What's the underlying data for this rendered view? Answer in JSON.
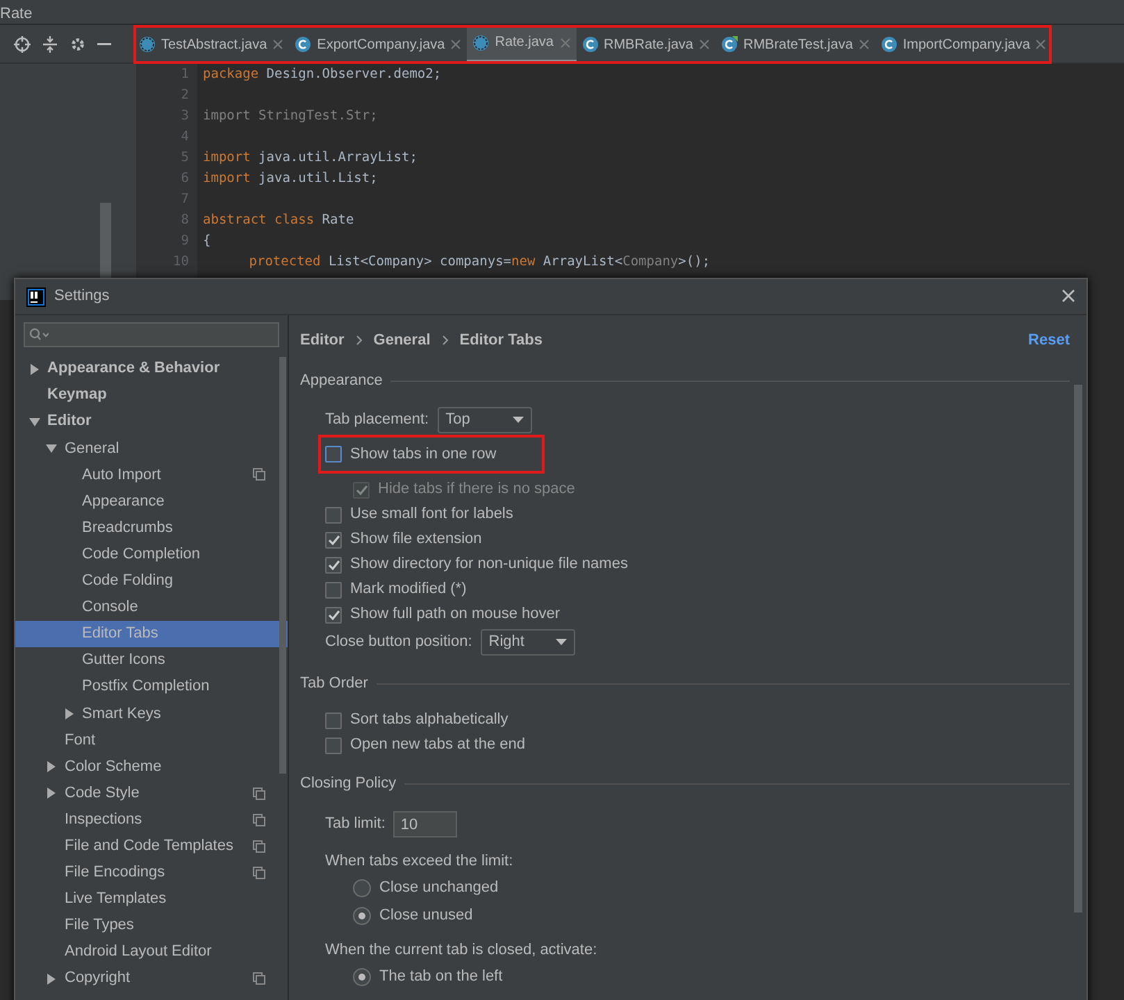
{
  "window": {
    "title": "Rate"
  },
  "editor_tabs": {
    "highlighted": true,
    "items": [
      {
        "label": "TestAbstract.java",
        "kind": "abstract",
        "selected": false
      },
      {
        "label": "ExportCompany.java",
        "kind": "class",
        "selected": false
      },
      {
        "label": "Rate.java",
        "kind": "abstract",
        "selected": true
      },
      {
        "label": "RMBRate.java",
        "kind": "class",
        "selected": false
      },
      {
        "label": "RMBrateTest.java",
        "kind": "test",
        "selected": false
      },
      {
        "label": "ImportCompany.java",
        "kind": "class",
        "selected": false
      }
    ]
  },
  "code": [
    {
      "number": "1",
      "segments": [
        {
          "kind": "keyword",
          "text": "package"
        },
        {
          "kind": "plain",
          "text": " Design.Observer.demo2;"
        }
      ]
    },
    {
      "number": "2"
    },
    {
      "number": "3",
      "segments": [
        {
          "kind": "muted",
          "text": "import StringTest.Str;"
        }
      ]
    },
    {
      "number": "4"
    },
    {
      "number": "5",
      "segments": [
        {
          "kind": "keyword",
          "text": "import"
        },
        {
          "kind": "plain",
          "text": " java.util.ArrayList;"
        }
      ]
    },
    {
      "number": "6",
      "segments": [
        {
          "kind": "keyword",
          "text": "import"
        },
        {
          "kind": "plain",
          "text": " java.util.List;"
        }
      ]
    },
    {
      "number": "7"
    },
    {
      "number": "8",
      "segments": [
        {
          "kind": "keyword",
          "text": "abstract class"
        },
        {
          "kind": "plain",
          "text": " Rate"
        }
      ]
    },
    {
      "number": "9",
      "segments": [
        {
          "kind": "plain",
          "text": "{"
        }
      ]
    },
    {
      "number": "10",
      "indented": true,
      "segments": [
        {
          "kind": "keyword",
          "text": "protected"
        },
        {
          "kind": "plain",
          "text": " List<Company> companys="
        },
        {
          "kind": "keyword",
          "text": "new"
        },
        {
          "kind": "plain",
          "text": " ArrayList<"
        },
        {
          "kind": "muted",
          "text": "Company"
        },
        {
          "kind": "plain",
          "text": ">();"
        }
      ]
    }
  ],
  "dialog": {
    "title": "Settings",
    "tree": [
      {
        "label": "Appearance & Behavior",
        "expanded": false,
        "shared": false,
        "selected": false
      },
      {
        "label": "Keymap",
        "shared": false,
        "selected": false
      },
      {
        "label": "Editor",
        "expanded": true,
        "shared": false,
        "selected": false,
        "children": [
          {
            "label": "General",
            "expanded": true,
            "shared": false,
            "selected": false,
            "children": [
              {
                "label": "Auto Import",
                "shared": true,
                "selected": false
              },
              {
                "label": "Appearance",
                "shared": false,
                "selected": false
              },
              {
                "label": "Breadcrumbs",
                "shared": false,
                "selected": false
              },
              {
                "label": "Code Completion",
                "shared": false,
                "selected": false
              },
              {
                "label": "Code Folding",
                "shared": false,
                "selected": false
              },
              {
                "label": "Console",
                "shared": false,
                "selected": false
              },
              {
                "label": "Editor Tabs",
                "shared": false,
                "selected": true
              },
              {
                "label": "Gutter Icons",
                "shared": false,
                "selected": false
              },
              {
                "label": "Postfix Completion",
                "shared": false,
                "selected": false
              },
              {
                "label": "Smart Keys",
                "expanded": false,
                "shared": false,
                "selected": false
              }
            ]
          },
          {
            "label": "Font",
            "shared": false,
            "selected": false
          },
          {
            "label": "Color Scheme",
            "expanded": false,
            "shared": false,
            "selected": false
          },
          {
            "label": "Code Style",
            "expanded": false,
            "shared": true,
            "selected": false
          },
          {
            "label": "Inspections",
            "shared": true,
            "selected": false
          },
          {
            "label": "File and Code Templates",
            "shared": true,
            "selected": false
          },
          {
            "label": "File Encodings",
            "shared": true,
            "selected": false
          },
          {
            "label": "Live Templates",
            "shared": false,
            "selected": false
          },
          {
            "label": "File Types",
            "shared": false,
            "selected": false
          },
          {
            "label": "Android Layout Editor",
            "shared": false,
            "selected": false
          },
          {
            "label": "Copyright",
            "expanded": false,
            "shared": true,
            "selected": false
          }
        ]
      }
    ],
    "breadcrumb": [
      "Editor",
      "General",
      "Editor Tabs"
    ],
    "reset": "Reset",
    "sections": [
      {
        "title": "Appearance",
        "items": [
          {
            "kind": "select",
            "label": "Tab placement:",
            "value": "Top"
          },
          {
            "kind": "checkbox",
            "label": "Show tabs in one row",
            "checked": false,
            "disabled": false,
            "highlighted": true,
            "children": [
              {
                "kind": "checkbox",
                "label": "Hide tabs if there is no space",
                "checked": true,
                "disabled": true,
                "highlighted": false
              }
            ]
          },
          {
            "kind": "checkbox",
            "label": "Use small font for labels",
            "checked": false,
            "disabled": false,
            "highlighted": false
          },
          {
            "kind": "checkbox",
            "label": "Show file extension",
            "checked": true,
            "disabled": false,
            "highlighted": false
          },
          {
            "kind": "checkbox",
            "label": "Show directory for non-unique file names",
            "checked": true,
            "disabled": false,
            "highlighted": false
          },
          {
            "kind": "checkbox",
            "label": "Mark modified (*)",
            "checked": false,
            "disabled": false,
            "highlighted": false
          },
          {
            "kind": "checkbox",
            "label": "Show full path on mouse hover",
            "checked": true,
            "disabled": false,
            "highlighted": false
          },
          {
            "kind": "select",
            "label": "Close button position:",
            "value": "Right"
          }
        ]
      },
      {
        "title": "Tab Order",
        "items": [
          {
            "kind": "checkbox",
            "label": "Sort tabs alphabetically",
            "checked": false,
            "disabled": false,
            "highlighted": false
          },
          {
            "kind": "checkbox",
            "label": "Open new tabs at the end",
            "checked": false,
            "disabled": false,
            "highlighted": false
          }
        ]
      },
      {
        "title": "Closing Policy",
        "items": [
          {
            "kind": "input",
            "label": "Tab limit:",
            "value": "10"
          },
          {
            "kind": "label",
            "label": "When tabs exceed the limit:",
            "children": [
              {
                "kind": "radio",
                "label": "Close unchanged",
                "selected": false
              },
              {
                "kind": "radio",
                "label": "Close unused",
                "selected": true
              }
            ]
          },
          {
            "kind": "label",
            "label": "When the current tab is closed, activate:",
            "children": [
              {
                "kind": "radio",
                "label": "The tab on the left",
                "selected": true
              }
            ]
          }
        ]
      }
    ]
  }
}
